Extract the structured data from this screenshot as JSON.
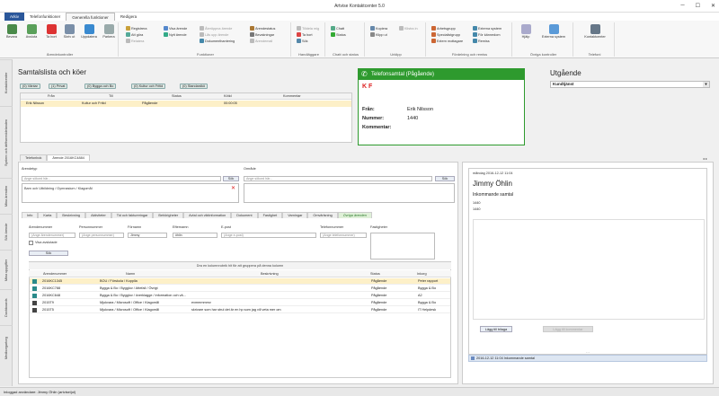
{
  "app": {
    "title": "Artvise Kontaktcenter 5.0"
  },
  "menu": {
    "arkiv": "Arkiv",
    "items": [
      "Telefonfunktioner",
      "Generella funktioner",
      "Redigera"
    ]
  },
  "ribbon": {
    "groups": [
      "Ärendekontroller",
      "Funktioner",
      "Handläggare",
      "Chatt och status",
      "Urklipp",
      "Fördelning och remiss",
      "Övriga kontroller",
      "Telefoni"
    ],
    "big": [
      "Bevara",
      "Avsluta",
      "Ta bort",
      "Skriv ut",
      "Uppdatera",
      "Parkera",
      "Hjälp",
      "Externa system",
      "Kontaktcenter"
    ],
    "small": [
      "Registrera",
      "Att göra",
      "Relatera",
      "Visa ärende",
      "Nytt ärende",
      "Återöppna ärende",
      "Lås upp ärende",
      "Dokumenthantering",
      "Ärendestatus",
      "Bevakningar",
      "Ärendemall",
      "Tilldela mig",
      "Ta bort",
      "Sök",
      "Chatt",
      "Status",
      "Kopiera",
      "Klipp ut",
      "Klistra in",
      "Arbetsgrupp",
      "Specialistgrupp",
      "Extern mottagare",
      "Externa system",
      "För kännedom",
      "Remiss"
    ]
  },
  "sidebar": {
    "tabs": [
      "Kontaktcenter",
      "System och driftsmeddelanden",
      "Mina ärenden",
      "Sök ärende",
      "Mina uppgifter",
      "Dashboards",
      "Medborgartorg"
    ]
  },
  "queue": {
    "title": "Samtalslista och köer",
    "chips": [
      "(0) Väntar",
      "(1) Privat",
      "(0) Bygga och Bo",
      "(0) Kultur och Fritid",
      "(0) Standardkö"
    ],
    "columns": [
      "Från",
      "Till",
      "Status",
      "Kötid",
      "Kommentar"
    ],
    "rows": [
      {
        "from": "Erik Nilsson",
        "to": "Kultur och Fritid",
        "status": "Pågående",
        "time": "00:00:05",
        "comment": ""
      }
    ]
  },
  "call": {
    "title": "Telefonsamtal (Pågående)",
    "initials": "K F",
    "fields": [
      {
        "label": "Från:",
        "value": "Erik Nilsson"
      },
      {
        "label": "Nummer:",
        "value": "1440"
      },
      {
        "label": "Kommentar:",
        "value": ""
      }
    ]
  },
  "outgoing": {
    "title": "Utgående",
    "select": "Kundtjänst"
  },
  "doctabs": [
    "Telefonbok",
    "Ärende 2016KC4884"
  ],
  "case": {
    "typeLabel": "Ärendetyp",
    "typePlaceholder": "Ange sökord här...",
    "searchBtn": "Sök",
    "typeValue": "Barn och Utbildning / Gymnasium / Klagomål",
    "areaLabel": "Område",
    "areaPlaceholder": "Ange sökord här...",
    "tabs": [
      "Info",
      "Karta",
      "Beskrivning",
      "Aktiviteter",
      "Tid och faktureringar",
      "Behörigheter",
      "Avtal och viktinformation",
      "Dokument",
      "Fastighet",
      "Varningar",
      "Omvärlsning",
      "Övriga ärenden"
    ],
    "filters": [
      {
        "label": "Ärendenummer",
        "placeholder": "(Ange ärendenummer)"
      },
      {
        "label": "Personnummer",
        "placeholder": "(Ange personnummer)"
      },
      {
        "label": "Förnamn",
        "placeholder": "Jimmy"
      },
      {
        "label": "Efternamn",
        "placeholder": "öhlin"
      },
      {
        "label": "E-post",
        "placeholder": "(Ange e-post)"
      },
      {
        "label": "Telefonnummer",
        "placeholder": "(Ange telefonnummer)"
      },
      {
        "label": "Fastigheter",
        "placeholder": ""
      }
    ],
    "showClosed": "Visa avslutade",
    "search": "Sök",
    "groupHint": "Dra en kolumnrubrik hit för att gruppera på denna kolumn",
    "columns": [
      "Ärendenummer",
      "Namn",
      "Beskrivning",
      "Status",
      "Inkorg"
    ],
    "rows": [
      {
        "id": "2016KC1345",
        "name": "BOU / Förskola / Kopplla",
        "desc": "",
        "status": "Pågående",
        "inbox": "Peter rapport",
        "color": "#2a8a8a"
      },
      {
        "id": "2016KC788",
        "name": "Bygga & Bo / Bygglov / Attefall / Övrigt",
        "desc": "",
        "status": "Pågående",
        "inbox": "Bygga & Bo",
        "color": "#2a8a8a"
      },
      {
        "id": "2016KC648",
        "name": "Bygga & Bo / Bygglov / överklagge / information och vä...",
        "desc": "",
        "status": "Pågående",
        "inbox": "A2",
        "color": "#2a8a8a"
      },
      {
        "id": "2015T9",
        "name": "Mjukvara / Microsoft / Office / Klagomål",
        "desc": "evmmmmmv",
        "status": "Pågående",
        "inbox": "Bygga & Bo",
        "color": "#444"
      },
      {
        "id": "2015T5",
        "name": "Mjukvara / Microsoft / Office / Klagomål",
        "desc": "skrivare som har strul det är en hp som jag vill veta mer om",
        "status": "Pågående",
        "inbox": "IT Helpdesk",
        "color": "#444"
      }
    ]
  },
  "detail": {
    "date": "måndag 2016-12-12 11:04",
    "name": "Jimmy Öhlin",
    "subject": "Inkommande samtal",
    "num1": "1440",
    "num2": "1440",
    "addBtn": "Lägg till bilaga",
    "addBtn2": "Lägg till kommentar",
    "footer": "2016-12-12 11:04 Inkommande samtal"
  },
  "status": {
    "text": "Inloggad användare: Jimmy Öhlin (artvise\\jol)"
  }
}
